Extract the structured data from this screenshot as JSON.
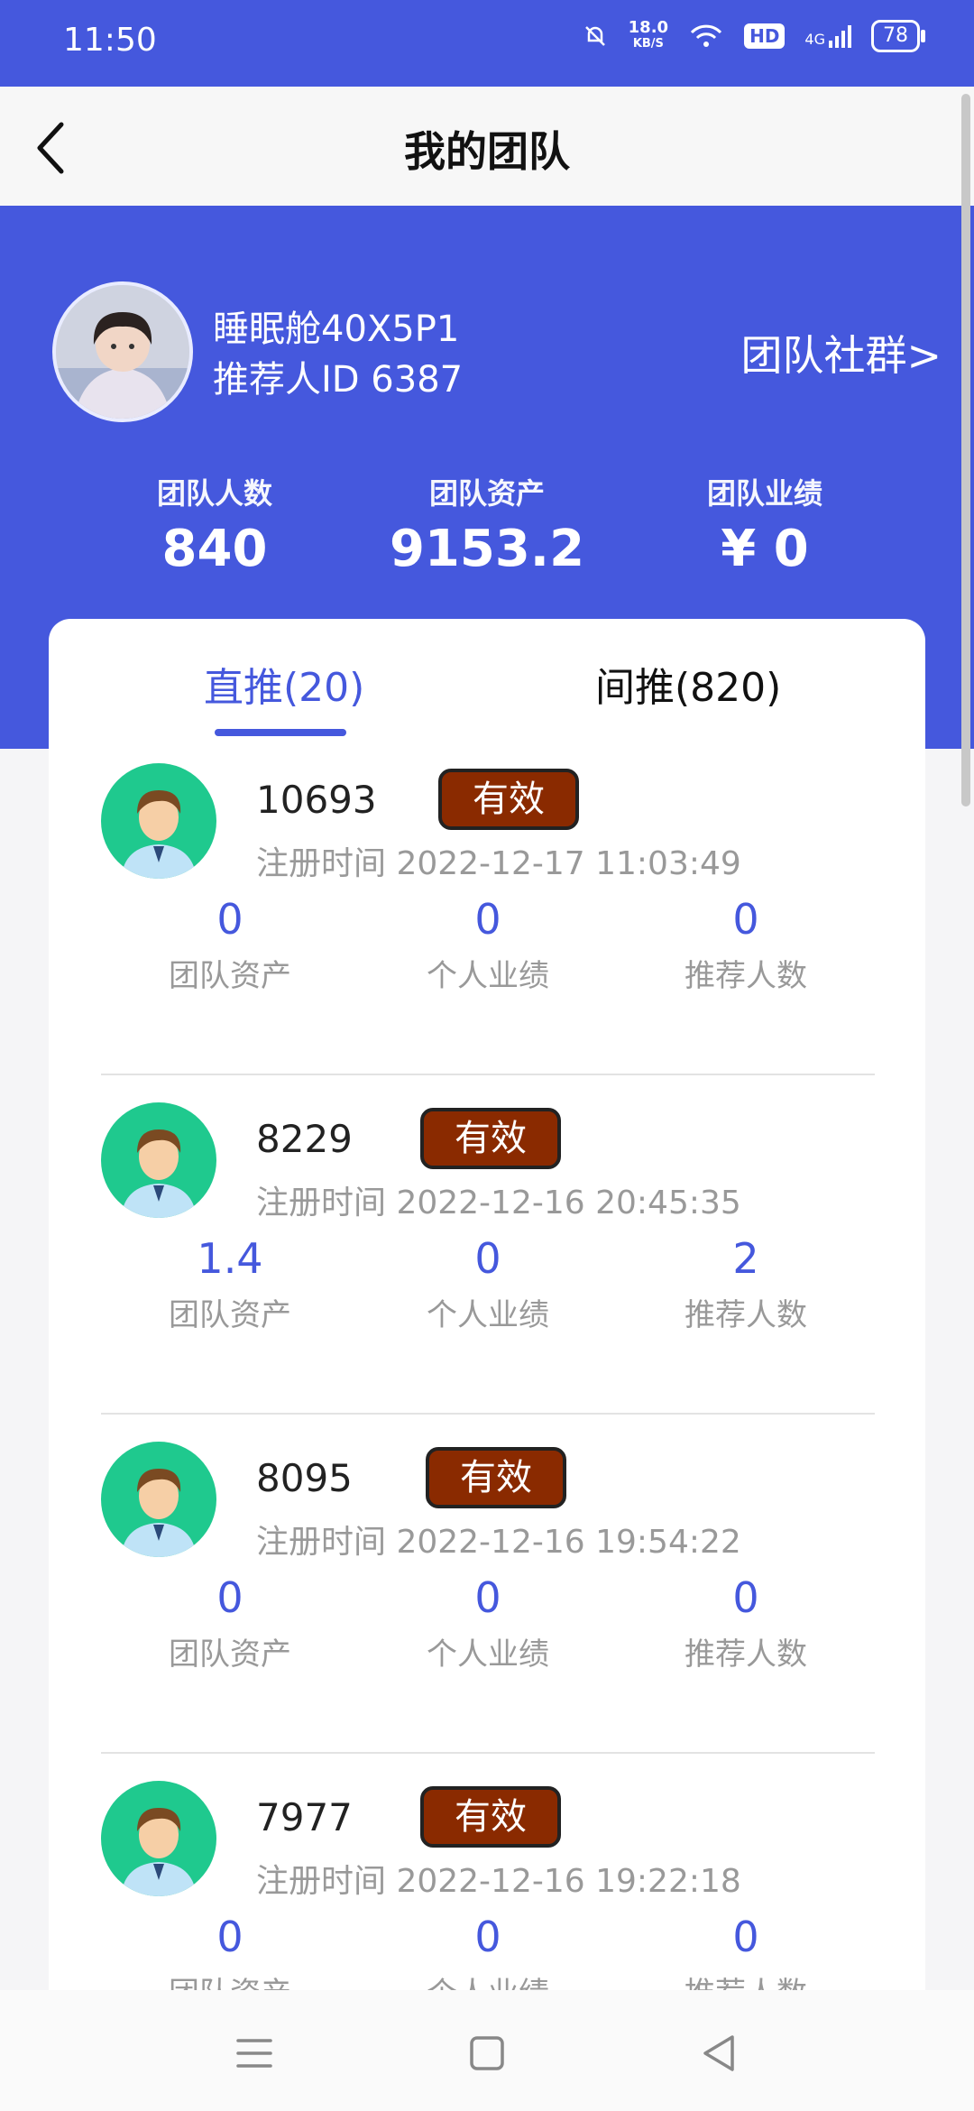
{
  "status": {
    "time": "11:50",
    "speed_value": "18.0",
    "speed_unit": "KB/S",
    "hd": "HD",
    "network": "4G",
    "battery": "78"
  },
  "nav": {
    "title": "我的团队"
  },
  "profile": {
    "name": "睡眠舱40X5P1",
    "referrer": "推荐人ID 6387",
    "community": "团队社群>"
  },
  "stats": [
    {
      "label": "团队人数",
      "value": "840"
    },
    {
      "label": "团队资产",
      "value": "9153.2"
    },
    {
      "label": "团队业绩",
      "value": "¥ 0"
    }
  ],
  "tabs": [
    {
      "label": "直推(20)",
      "active": true
    },
    {
      "label": "间推(820)",
      "active": false
    }
  ],
  "members": [
    {
      "id": "10693",
      "status": "有效",
      "registered": "注册时间 2022-12-17 11:03:49",
      "metrics": [
        {
          "value": "0",
          "label": "团队资产"
        },
        {
          "value": "0",
          "label": "个人业绩"
        },
        {
          "value": "0",
          "label": "推荐人数"
        }
      ]
    },
    {
      "id": "8229",
      "status": "有效",
      "registered": "注册时间 2022-12-16 20:45:35",
      "metrics": [
        {
          "value": "1.4",
          "label": "团队资产"
        },
        {
          "value": "0",
          "label": "个人业绩"
        },
        {
          "value": "2",
          "label": "推荐人数"
        }
      ]
    },
    {
      "id": "8095",
      "status": "有效",
      "registered": "注册时间 2022-12-16 19:54:22",
      "metrics": [
        {
          "value": "0",
          "label": "团队资产"
        },
        {
          "value": "0",
          "label": "个人业绩"
        },
        {
          "value": "0",
          "label": "推荐人数"
        }
      ]
    },
    {
      "id": "7977",
      "status": "有效",
      "registered": "注册时间 2022-12-16 19:22:18",
      "metrics": [
        {
          "value": "0",
          "label": "团队资产"
        },
        {
          "value": "0",
          "label": "个人业绩"
        },
        {
          "value": "0",
          "label": "推荐人数"
        }
      ]
    }
  ],
  "colors": {
    "primary": "#4558dd",
    "badge": "#8a2a00",
    "member_avatar_bg": "#1fc98e"
  },
  "icons": [
    "back-arrow-icon",
    "menu-icon",
    "home-icon",
    "back-triangle-icon"
  ]
}
